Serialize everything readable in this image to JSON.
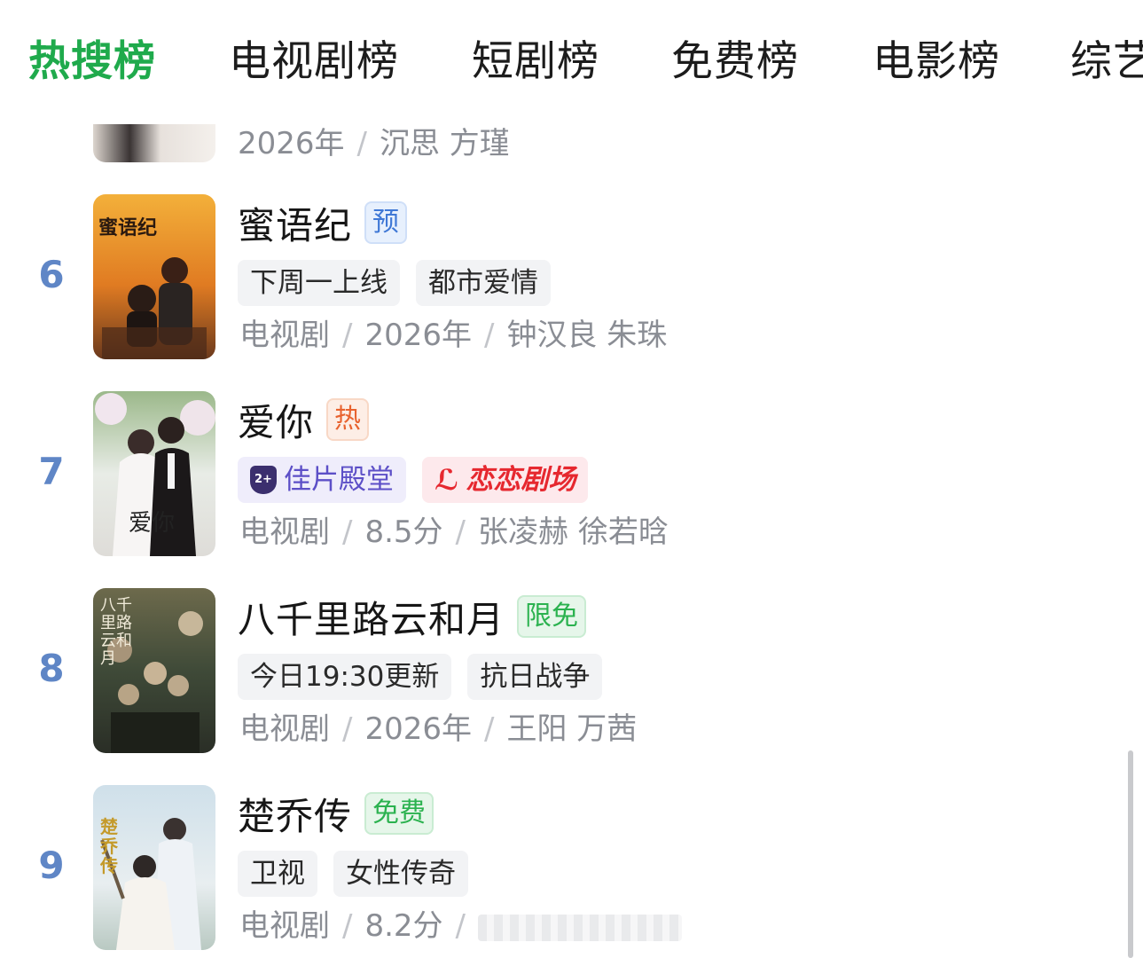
{
  "tabs": [
    {
      "label": "热搜榜",
      "active": true
    },
    {
      "label": "电视剧榜",
      "active": false
    },
    {
      "label": "短剧榜",
      "active": false
    },
    {
      "label": "免费榜",
      "active": false
    },
    {
      "label": "电影榜",
      "active": false
    },
    {
      "label": "综艺榜",
      "active": false
    }
  ],
  "partial_item": {
    "year": "2026年",
    "cast": "沉思 方瑾"
  },
  "items": [
    {
      "rank": "6",
      "title": "蜜语纪",
      "badge": "预",
      "badge_color": "blue",
      "tags": [
        "下周一上线",
        "都市爱情"
      ],
      "type": "电视剧",
      "info": "2026年",
      "cast": "钟汉良 朱珠",
      "poster_text": "蜜语纪"
    },
    {
      "rank": "7",
      "title": "爱你",
      "badge": "热",
      "badge_color": "orange",
      "tags": [
        "佳片殿堂",
        "恋恋剧场"
      ],
      "tag_icons": [
        "2+",
        "ℒ"
      ],
      "type": "电视剧",
      "info": "8.5分",
      "cast": "张凌赫 徐若晗",
      "poster_text": "爱你"
    },
    {
      "rank": "8",
      "title": "八千里路云和月",
      "badge": "限免",
      "badge_color": "green",
      "tags": [
        "今日19:30更新",
        "抗日战争"
      ],
      "type": "电视剧",
      "info": "2026年",
      "cast": "王阳 万茜",
      "poster_text": "八千里路云和月"
    },
    {
      "rank": "9",
      "title": "楚乔传",
      "badge": "免费",
      "badge_color": "green",
      "tags": [
        "卫视",
        "女性传奇"
      ],
      "type": "电视剧",
      "info": "8.2分",
      "cast": "",
      "poster_text": "楚乔传"
    }
  ],
  "separator": "/",
  "colors": {
    "active_tab": "#1faa4c",
    "rank": "#5f86c6",
    "meta_text": "#8a8d94"
  }
}
